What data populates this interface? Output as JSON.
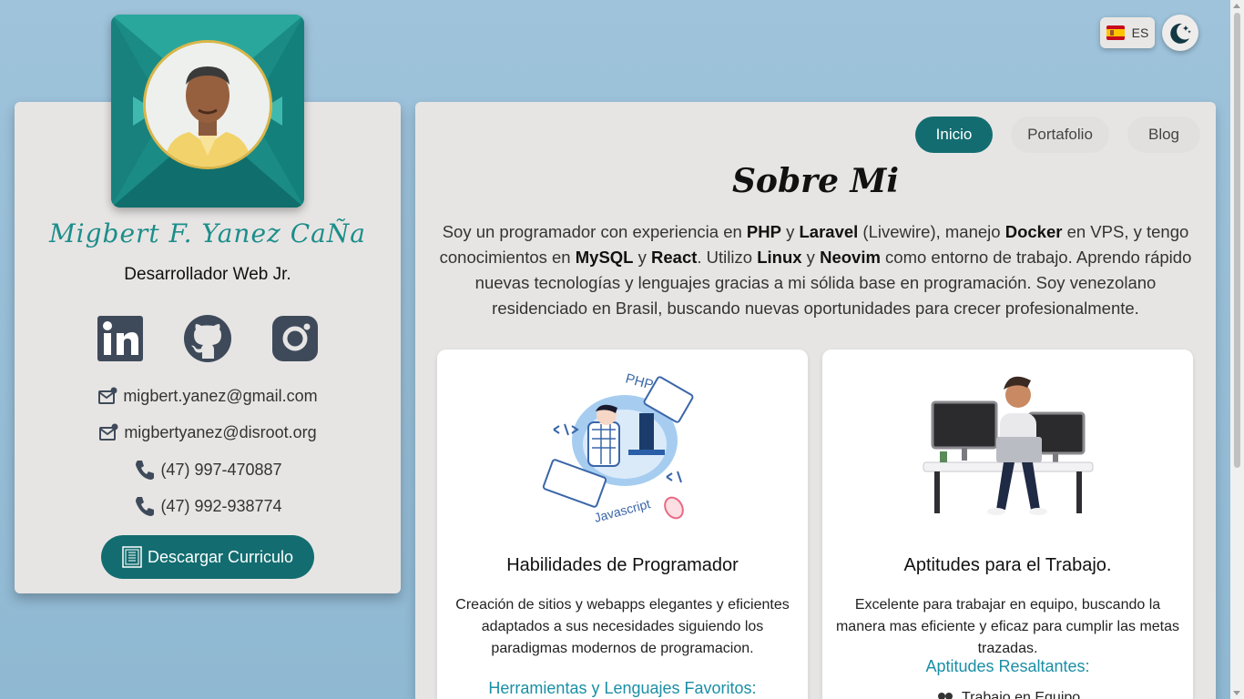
{
  "header": {
    "language": {
      "code": "ES",
      "flag_icon": "spain-flag-icon"
    },
    "theme_toggle_icon": "moon-stars-icon"
  },
  "profile": {
    "name": "Migbert F. Yanez CaÑa",
    "role": "Desarrollador Web Jr.",
    "social": [
      "linkedin-icon",
      "github-icon",
      "instagram-icon"
    ],
    "emails": [
      "migbert.yanez@gmail.com",
      "migbertyanez@disroot.org"
    ],
    "phones": [
      "(47) 997-470887",
      "(47) 992-938774"
    ],
    "download_label": "Descargar Curriculo",
    "accent": "#1c8e8a",
    "button_color": "#136d70"
  },
  "nav": {
    "tabs": [
      {
        "label": "Inicio",
        "active": true
      },
      {
        "label": "Portafolio",
        "active": false
      },
      {
        "label": "Blog",
        "active": false
      }
    ]
  },
  "about": {
    "title": "Sobre Mi",
    "text_parts": [
      "Soy un programador con experiencia en ",
      "PHP",
      " y ",
      "Laravel",
      " (Livewire), manejo ",
      "Docker",
      " en VPS, y tengo conocimientos en ",
      "MySQL",
      " y ",
      "React",
      ". Utilizo ",
      "Linux",
      " y ",
      "Neovim",
      " como entorno de trabajo. Aprendo rápido nuevas tecnologías y lenguajes gracias a mi sólida base en programación. Soy venezolano residenciado en Brasil, buscando nuevas oportunidades para crecer profesionalmente."
    ]
  },
  "cards": [
    {
      "title": "Habilidades de Programador",
      "description": "Creación de sitios y webapps elegantes y eficientes adaptados a sus necesidades siguiendo los paradigmas modernos de programacion.",
      "subtitle": "Herramientas y Lenguajes Favoritos:",
      "illustration_labels": [
        "PHP",
        "Javascript"
      ]
    },
    {
      "title": "Aptitudes para el Trabajo.",
      "description": "Excelente para trabajar en equipo, buscando la manera mas eficiente y eficaz para cumplir las metas trazadas.",
      "subtitle": "Aptitudes Resaltantes:",
      "first_item": "Trabajo en Equipo"
    }
  ]
}
